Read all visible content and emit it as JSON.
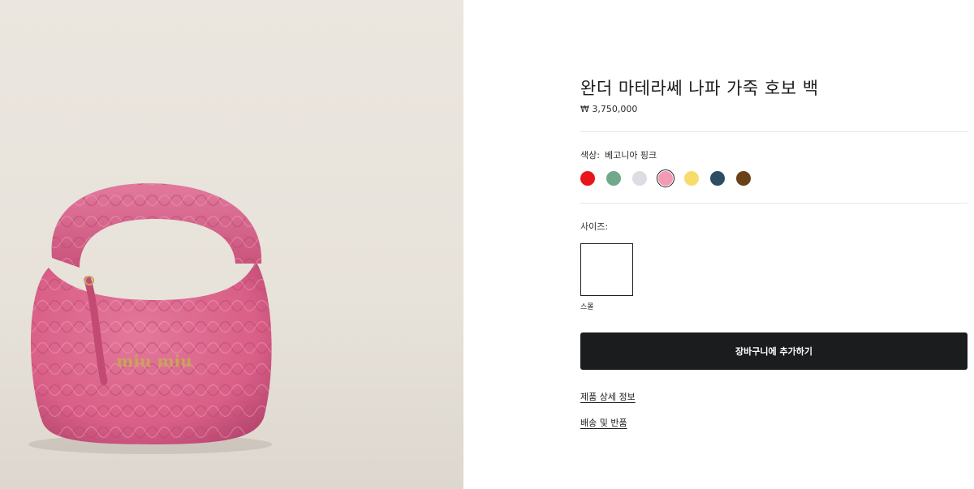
{
  "product": {
    "title": "완더 마테라쎄 나파 가죽 호보 백",
    "price": "₩ 3,750,000",
    "image_logo_text": "miu miu"
  },
  "color": {
    "label": "색상:",
    "selected_value": "베고니아 핑크",
    "swatches": [
      {
        "name": "red",
        "hex": "#e8161b"
      },
      {
        "name": "sage-green",
        "hex": "#6fa88b"
      },
      {
        "name": "light-grey",
        "hex": "#dcdde3"
      },
      {
        "name": "begonia-pink",
        "hex": "#f39ab5",
        "selected": true
      },
      {
        "name": "yellow",
        "hex": "#f6dd6b"
      },
      {
        "name": "dark-teal",
        "hex": "#2c4d63"
      },
      {
        "name": "brown",
        "hex": "#6a4019"
      }
    ]
  },
  "size": {
    "label": "사이즈:",
    "options": [
      {
        "name": "스몰"
      }
    ]
  },
  "actions": {
    "add_to_cart": "장바구니에 추가하기"
  },
  "links": {
    "details": "제품 상세 정보",
    "shipping": "배송 및 반품"
  }
}
